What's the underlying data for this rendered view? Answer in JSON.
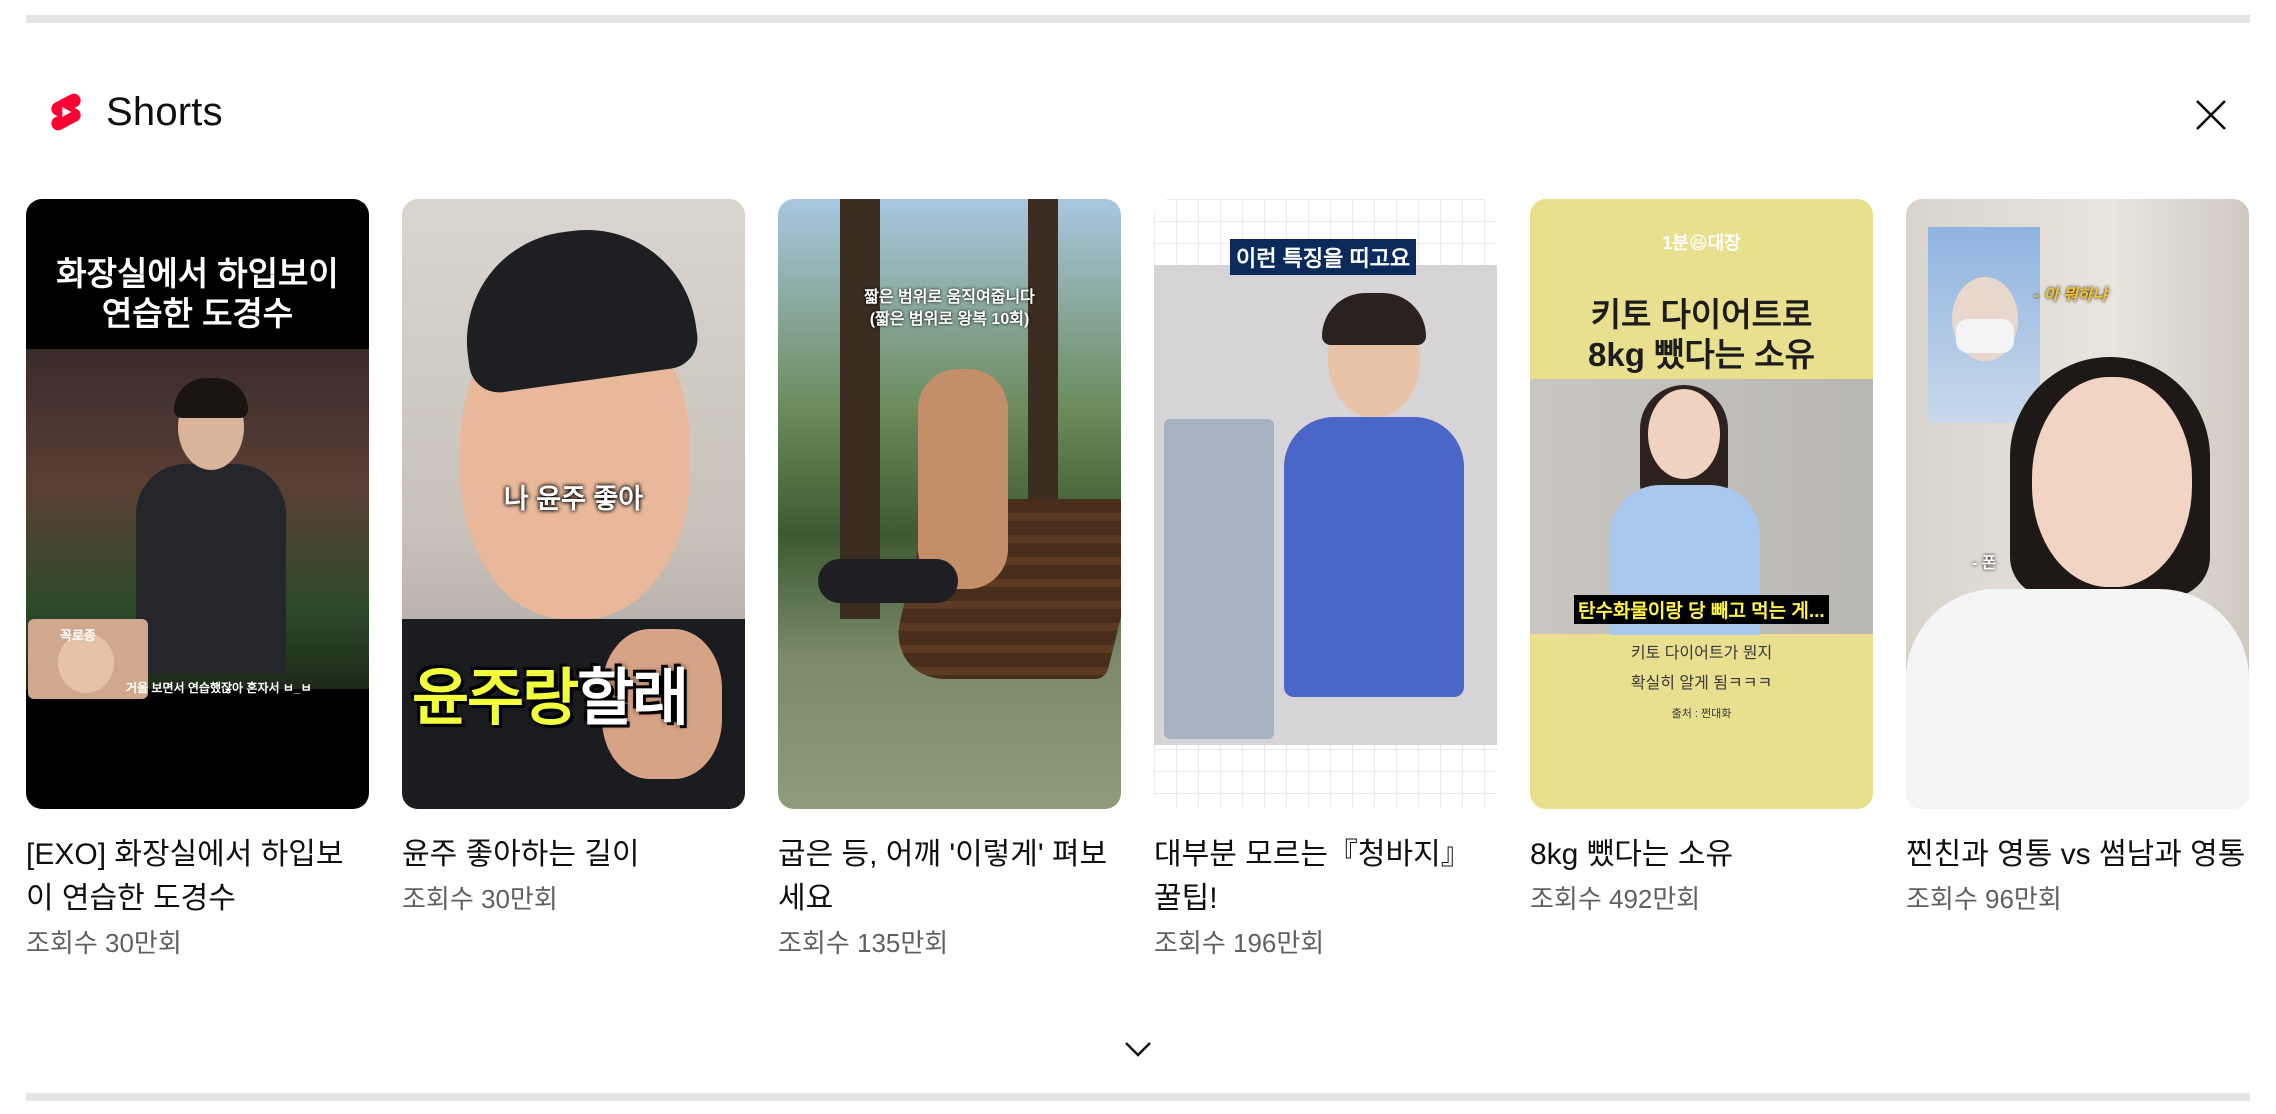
{
  "shelf": {
    "title": "Shorts",
    "brand_color": "#ff0033"
  },
  "icons": {
    "logo": "shorts-logo-icon",
    "close": "close-icon",
    "expand": "chevron-down-icon"
  },
  "cards": [
    {
      "title": "[EXO] 화장실에서 하입보이 연습한 도경수",
      "views": "조회수 30만회",
      "thumb_text": [
        "화장실에서 하입보이",
        "연습한 도경수",
        "꼭로종",
        "거울 보면서 연습했잖아 혼자서 ㅂ_ㅂ"
      ]
    },
    {
      "title": "윤주 좋아하는 길이",
      "views": "조회수 30만회",
      "thumb_text": [
        "나 윤주 좋아",
        "윤주랑",
        "할래"
      ]
    },
    {
      "title": "굽은 등, 어깨 '이렇게' 펴보세요",
      "views": "조회수 135만회",
      "thumb_text": [
        "짧은 범위로 움직여줍니다",
        "(짧은 범위로 왕복 10회)"
      ]
    },
    {
      "title": "대부분 모르는『청바지』꿀팁!",
      "views": "조회수 196만회",
      "thumb_text": [
        "이런 특징을 띠고요"
      ]
    },
    {
      "title": "8kg 뺐다는 소유",
      "views": "조회수 492만회",
      "thumb_text": [
        "1분😆대장",
        "키토 다이어트로",
        "8kg 뺐다는 소유",
        "탄수화물이랑 당 빼고 먹는 게...",
        "키토 다이어트가 뭔지",
        "확실히 알게 됨ㅋㅋㅋ",
        "출처 : 쩐대화"
      ]
    },
    {
      "title": "찐친과 영통 vs 썸남과 영통",
      "views": "조회수 96만회",
      "thumb_text": [
        "- 아 뭐하냐",
        "- 폰"
      ]
    }
  ]
}
